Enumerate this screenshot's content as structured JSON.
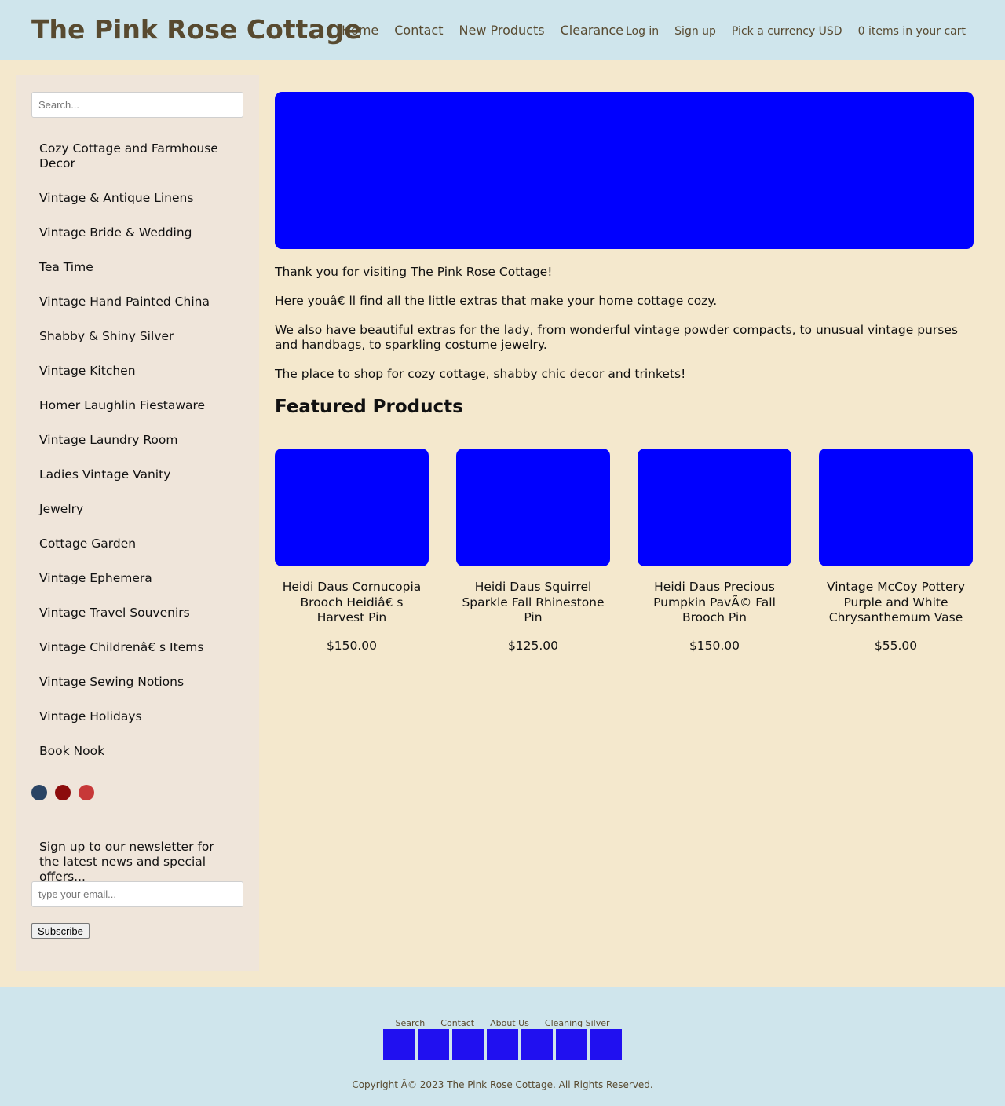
{
  "header": {
    "site_title": "The Pink Rose Cottage",
    "nav": [
      "Home",
      "Contact",
      "New Products",
      "Clearance"
    ],
    "user_links": {
      "login": "Log in",
      "signup": "Sign up",
      "currency": "Pick a currency USD",
      "cart": "0 items in your cart"
    }
  },
  "sidebar": {
    "search_placeholder": "Search...",
    "categories": [
      "Cozy Cottage and Farmhouse Decor",
      "Vintage & Antique Linens",
      "Vintage Bride & Wedding",
      "Tea Time",
      "Vintage Hand Painted China",
      "Shabby & Shiny Silver",
      "Vintage Kitchen",
      "Homer Laughlin Fiestaware",
      "Vintage Laundry Room",
      "Ladies Vintage Vanity",
      "Jewelry",
      "Cottage Garden",
      "Vintage Ephemera",
      "Vintage Travel Souvenirs",
      "Vintage Childrenâ€   s Items",
      "Vintage Sewing Notions",
      "Vintage Holidays",
      "Book Nook"
    ],
    "social_colors": [
      "#2a4464",
      "#8c0c0c",
      "#c73838"
    ],
    "newsletter_text": "Sign up to our newsletter for the latest news and special offers...",
    "email_placeholder": "type your email...",
    "subscribe_label": "Subscribe"
  },
  "main": {
    "intro": [
      "Thank you for visiting The Pink Rose Cottage!",
      "Here youâ€   ll find all the little extras that make your home cottage cozy.",
      "We also have beautiful extras for the lady, from wonderful vintage powder compacts, to unusual vintage purses and handbags, to sparkling costume jewelry.",
      "The place to shop for cozy cottage, shabby chic decor and trinkets!"
    ],
    "featured_heading": "Featured Products",
    "products": [
      {
        "name": "Heidi Daus Cornucopia Brooch Heidiâ€   s Harvest Pin",
        "price": "$150.00"
      },
      {
        "name": "Heidi Daus Squirrel Sparkle Fall Rhinestone Pin",
        "price": "$125.00"
      },
      {
        "name": "Heidi Daus Precious Pumpkin PavÃ© Fall Brooch Pin",
        "price": "$150.00"
      },
      {
        "name": "Vintage McCoy Pottery Purple and White Chrysanthemum Vase",
        "price": "$55.00"
      }
    ]
  },
  "footer": {
    "links": [
      "Search",
      "Contact",
      "About Us",
      "Cleaning Silver"
    ],
    "copyright": "Copyright Â© 2023 The Pink Rose Cottage. All Rights Reserved."
  },
  "colors": {
    "header_bg": "#cfe5ec",
    "page_bg": "#f4e8cd",
    "sidebar_bg": "#efe5da",
    "title_color": "#584a30",
    "image_placeholder": "#0000ff"
  }
}
